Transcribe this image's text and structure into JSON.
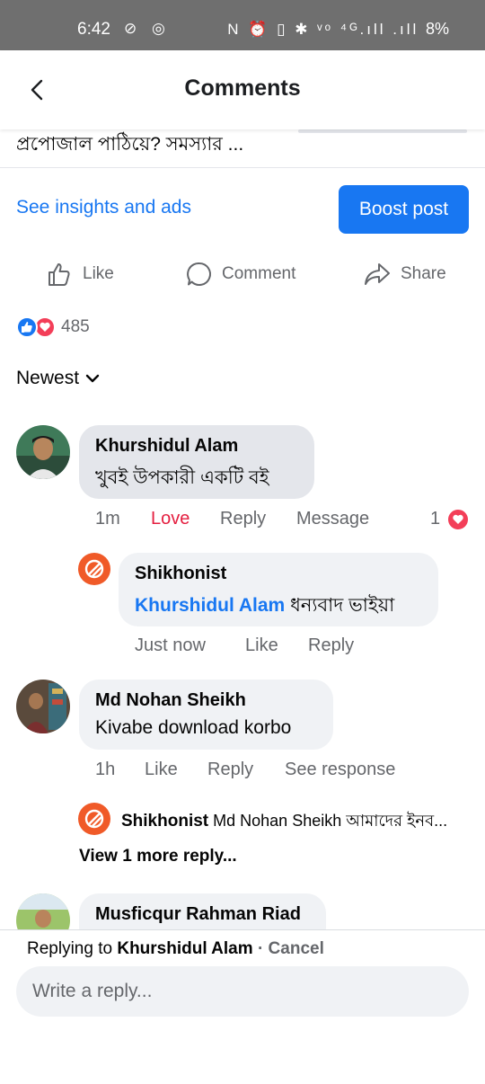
{
  "status": {
    "time": "6:42",
    "left_icons": "⊘ ◎",
    "right_icons": "N ⏰ ▯ ✱ ᵛᵒ ⁴ᴳ.ıll .ıll",
    "battery": "8%"
  },
  "header": {
    "title": "Comments"
  },
  "post": {
    "snippet": "প্রপোজাল পাঠিয়ে? সমস্যার ...",
    "insights_label": "See insights and ads",
    "boost_label": "Boost post"
  },
  "actions": {
    "like": "Like",
    "comment": "Comment",
    "share": "Share"
  },
  "reactions": {
    "count": "485"
  },
  "sort": {
    "label": "Newest"
  },
  "comments": [
    {
      "author": "Khurshidul Alam",
      "text": "খুবই উপকারী একটি বই",
      "time": "1m",
      "love": "Love",
      "reply": "Reply",
      "message": "Message",
      "reaction_count": "1",
      "replies": [
        {
          "author": "Shikhonist",
          "mention": "Khurshidul Alam",
          "text": "ধন্যবাদ ভাইয়া",
          "time": "Just now",
          "like": "Like",
          "reply": "Reply"
        }
      ]
    },
    {
      "author": "Md Nohan Sheikh",
      "text": "Kivabe download korbo",
      "time": "1h",
      "like": "Like",
      "reply": "Reply",
      "see_response": "See response",
      "collapsed_reply": {
        "author": "Shikhonist",
        "text": "Md Nohan Sheikh আমাদের ইনব..."
      },
      "view_more": "View 1 more reply..."
    },
    {
      "author": "Musficqur Rahman Riad"
    }
  ],
  "composer": {
    "replying_prefix": "Replying to",
    "replying_name": "Khurshidul Alam",
    "separator": "·",
    "cancel": "Cancel",
    "placeholder": "Write a reply..."
  },
  "colors": {
    "accent": "#1877f2",
    "love": "#e41e3f",
    "page_avatar": "#f05a28",
    "bubble": "#e4e6eb"
  }
}
